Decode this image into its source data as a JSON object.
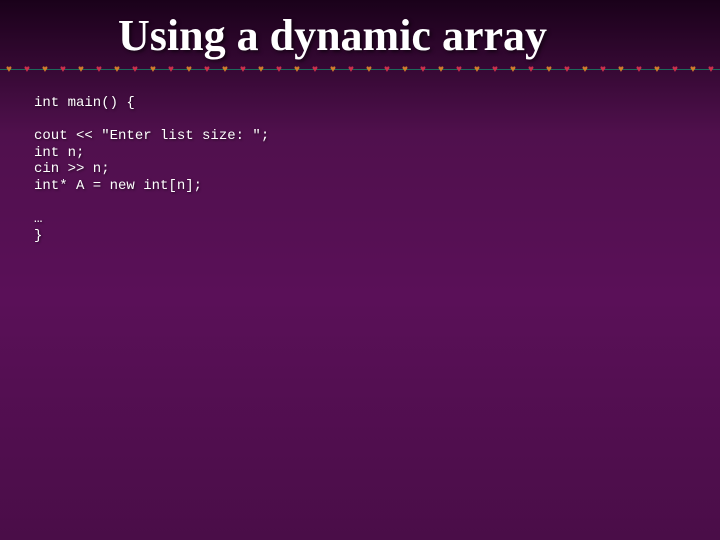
{
  "title": "Using a dynamic array",
  "code": {
    "l1": "int main() {",
    "l2": "cout << \"Enter list size: \";",
    "l3": "int n;",
    "l4": "cin >> n;",
    "l5": "int* A = new int[n];",
    "l6": "…",
    "l7": "}"
  }
}
